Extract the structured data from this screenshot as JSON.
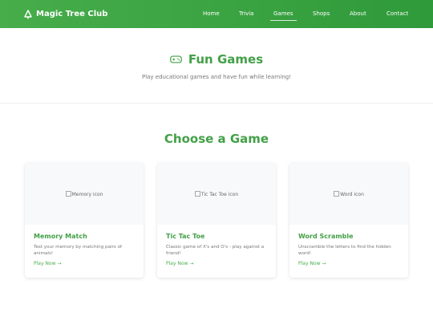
{
  "nav": {
    "brand": "Magic Tree Club",
    "links": [
      "Home",
      "Trivia",
      "Games",
      "Shops",
      "About",
      "Contact"
    ],
    "active": "Games"
  },
  "hero": {
    "title": "Fun Games",
    "subtitle": "Play educational games and have fun while learning!"
  },
  "section": {
    "title": "Choose a Game"
  },
  "games": [
    {
      "img_alt": "Memory icon",
      "title": "Memory Match",
      "desc": "Test your memory by matching pairs of animals!",
      "link": "Play Now →"
    },
    {
      "img_alt": "Tic Tac Toe icon",
      "title": "Tic Tac Toe",
      "desc": "Classic game of X's and O's - play against a friend!",
      "link": "Play Now →"
    },
    {
      "img_alt": "Word icon",
      "title": "Word Scramble",
      "desc": "Unscramble the letters to find the hidden word!",
      "link": "Play Now →"
    }
  ],
  "colors": {
    "brand_green": "#43a047",
    "nav_start": "#47ad4b",
    "nav_end": "#2f9a3a"
  },
  "icons": {
    "brand": "tree-icon",
    "hero": "gamepad-icon"
  }
}
